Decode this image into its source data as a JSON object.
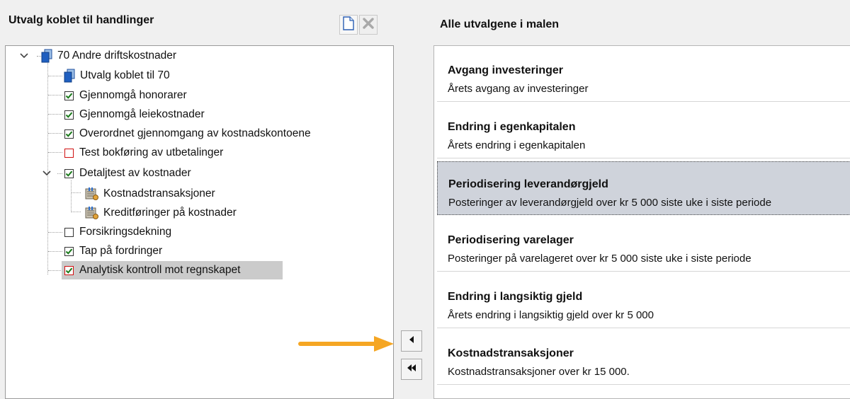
{
  "left_panel": {
    "title": "Utvalg koblet til handlinger",
    "tree": [
      {
        "label": "70 Andre driftskostnader",
        "icon": "document-stack-icon",
        "checkbox": null
      },
      {
        "label": "Utvalg koblet til 70",
        "icon": "document-stack-icon",
        "checkbox": null
      },
      {
        "label": "Gjennomgå honorarer",
        "checkbox": "checked"
      },
      {
        "label": "Gjennomgå leiekostnader",
        "checkbox": "checked"
      },
      {
        "label": "Overordnet gjennomgang av kostnadskontoene",
        "checkbox": "checked"
      },
      {
        "label": "Test bokføring av utbetalinger",
        "checkbox": "unchecked-red"
      },
      {
        "label": "Detaljtest av kostnader",
        "checkbox": "checked"
      },
      {
        "label": "Kostnadstransaksjoner",
        "icon": "selection-filter-icon",
        "checkbox": null
      },
      {
        "label": "Kreditføringer på kostnader",
        "icon": "selection-filter-icon",
        "checkbox": null
      },
      {
        "label": "Forsikringsdekning",
        "checkbox": "unchecked"
      },
      {
        "label": "Tap på fordringer",
        "checkbox": "checked"
      },
      {
        "label": "Analytisk kontroll mot regnskapet",
        "checkbox": "checked-red",
        "selected": true
      }
    ]
  },
  "toolbar": {
    "new_icon": "new-document-icon",
    "delete_icon": "delete-x-icon"
  },
  "move_buttons": {
    "move_one_icon": "arrow-left-icon",
    "move_all_icon": "double-arrow-left-icon"
  },
  "right_panel": {
    "title": "Alle utvalgene i malen",
    "items": [
      {
        "title": "Avgang investeringer",
        "description": "Årets avgang av investeringer"
      },
      {
        "title": "Endring i egenkapitalen",
        "description": "Årets endring i egenkapitalen"
      },
      {
        "title": "Periodisering leverandørgjeld",
        "description": "Posteringer av leverandørgjeld over kr 5 000 siste uke i siste periode",
        "selected": true
      },
      {
        "title": "Periodisering varelager",
        "description": "Posteringer på varelageret over kr 5 000 siste uke i siste periode"
      },
      {
        "title": "Endring i langsiktig gjeld",
        "description": "Årets endring i langsiktig gjeld over kr 5 000"
      },
      {
        "title": "Kostnadstransaksjoner",
        "description": "Kostnadstransaksjoner over kr 15 000."
      }
    ]
  },
  "annotation": {
    "arrow_color": "#f5a623"
  },
  "colors": {
    "check_green": "#1a7a1a",
    "checkbox_red_border": "#d01010",
    "selected_card_bg": "#cfd3db",
    "selected_tree_bg": "#cbcbcb"
  }
}
